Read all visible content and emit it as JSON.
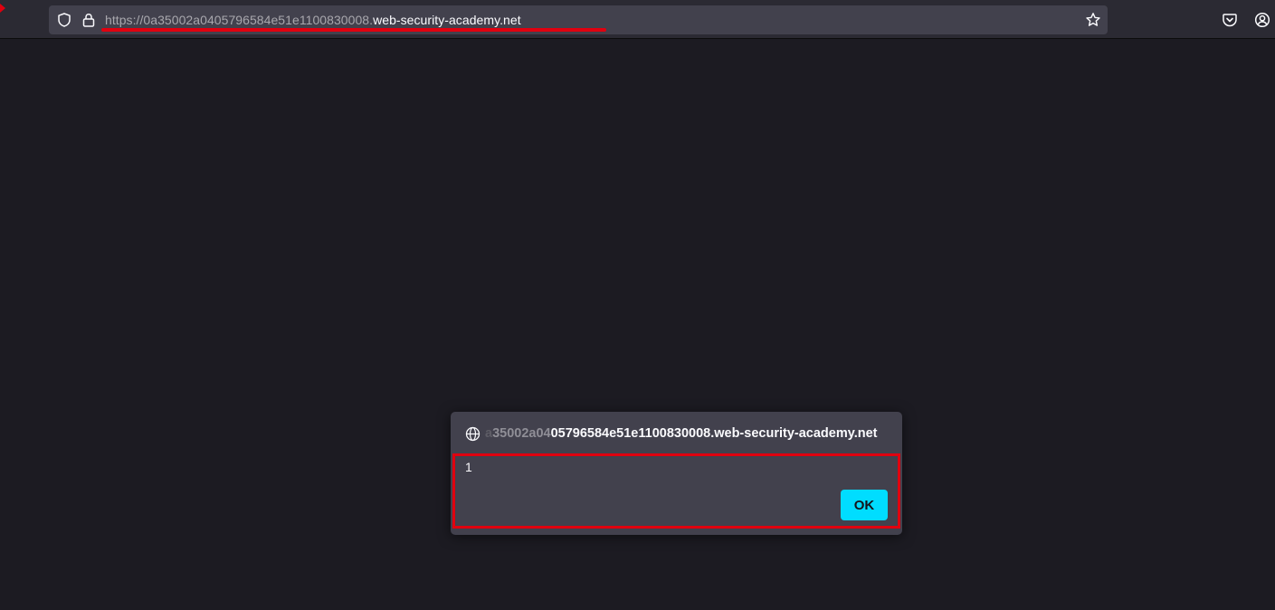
{
  "browser": {
    "url": {
      "scheme_and_subdomain": "https://0a35002a0405796584e51e1100830008.",
      "domain": "web-security-academy.net"
    },
    "icons": {
      "tracking_protection": "shield-icon",
      "site_security": "lock-icon",
      "bookmark": "star-icon",
      "pocket": "pocket-icon",
      "account": "account-icon"
    }
  },
  "dialog": {
    "origin_faded_a": "a",
    "origin_faded_b": "35002a04",
    "origin_main": "05796584e51e1100830008.web-security-academy.net",
    "message": "1",
    "ok_label": "OK",
    "icon": "globe-icon"
  },
  "colors": {
    "highlight": "#e0000f",
    "accent_button": "#00ddff",
    "page_background": "#1c1b22"
  }
}
